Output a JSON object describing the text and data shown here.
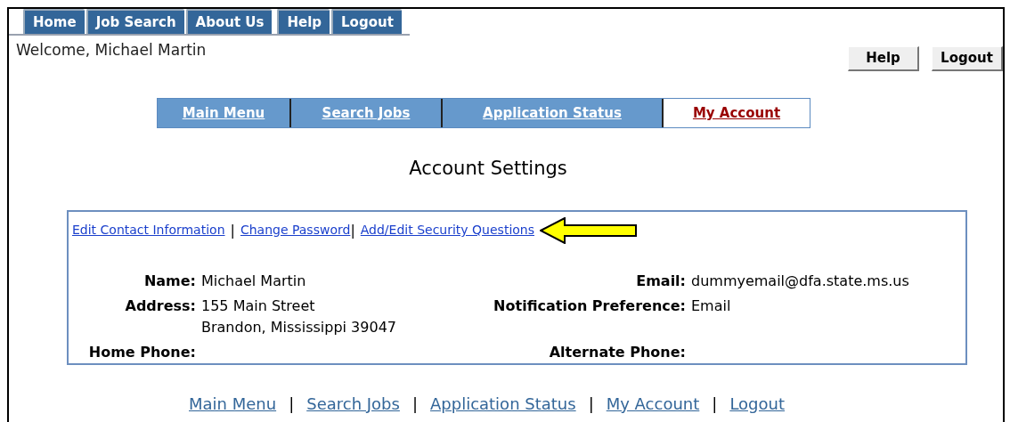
{
  "top_tabs": [
    {
      "label": "Home"
    },
    {
      "label": "Job Search"
    },
    {
      "label": "About Us"
    },
    {
      "label": "Help"
    },
    {
      "label": "Logout"
    }
  ],
  "welcome": "Welcome, Michael Martin",
  "header_buttons": [
    "Help",
    "Logout"
  ],
  "nav_tabs": [
    {
      "label": "Main Menu",
      "selected": false
    },
    {
      "label": "Search Jobs",
      "selected": false
    },
    {
      "label": "Application Status",
      "selected": false
    },
    {
      "label": "My Account",
      "selected": true
    }
  ],
  "page_title": "Account Settings",
  "account_links": [
    "Edit Contact Information",
    "Change Password",
    "Add/Edit Security Questions"
  ],
  "separator": "|",
  "left_fields": [
    {
      "label": "Name:",
      "lines": [
        "Michael Martin"
      ]
    },
    {
      "label": "Address:",
      "lines": [
        "155 Main Street",
        "Brandon, Mississippi 39047"
      ]
    },
    {
      "label": "Home Phone:"
    }
  ],
  "right_fields": [
    {
      "label": "Email:",
      "lines": [
        "dummyemail@dfa.state.ms.us"
      ]
    },
    {
      "label": "Notification Preference:",
      "lines": [
        "Email"
      ]
    },
    {
      "label": "Alternate Phone:"
    }
  ],
  "footer_links": [
    "Main Menu",
    "Search Jobs",
    "Application Status",
    "My Account",
    "Logout"
  ]
}
